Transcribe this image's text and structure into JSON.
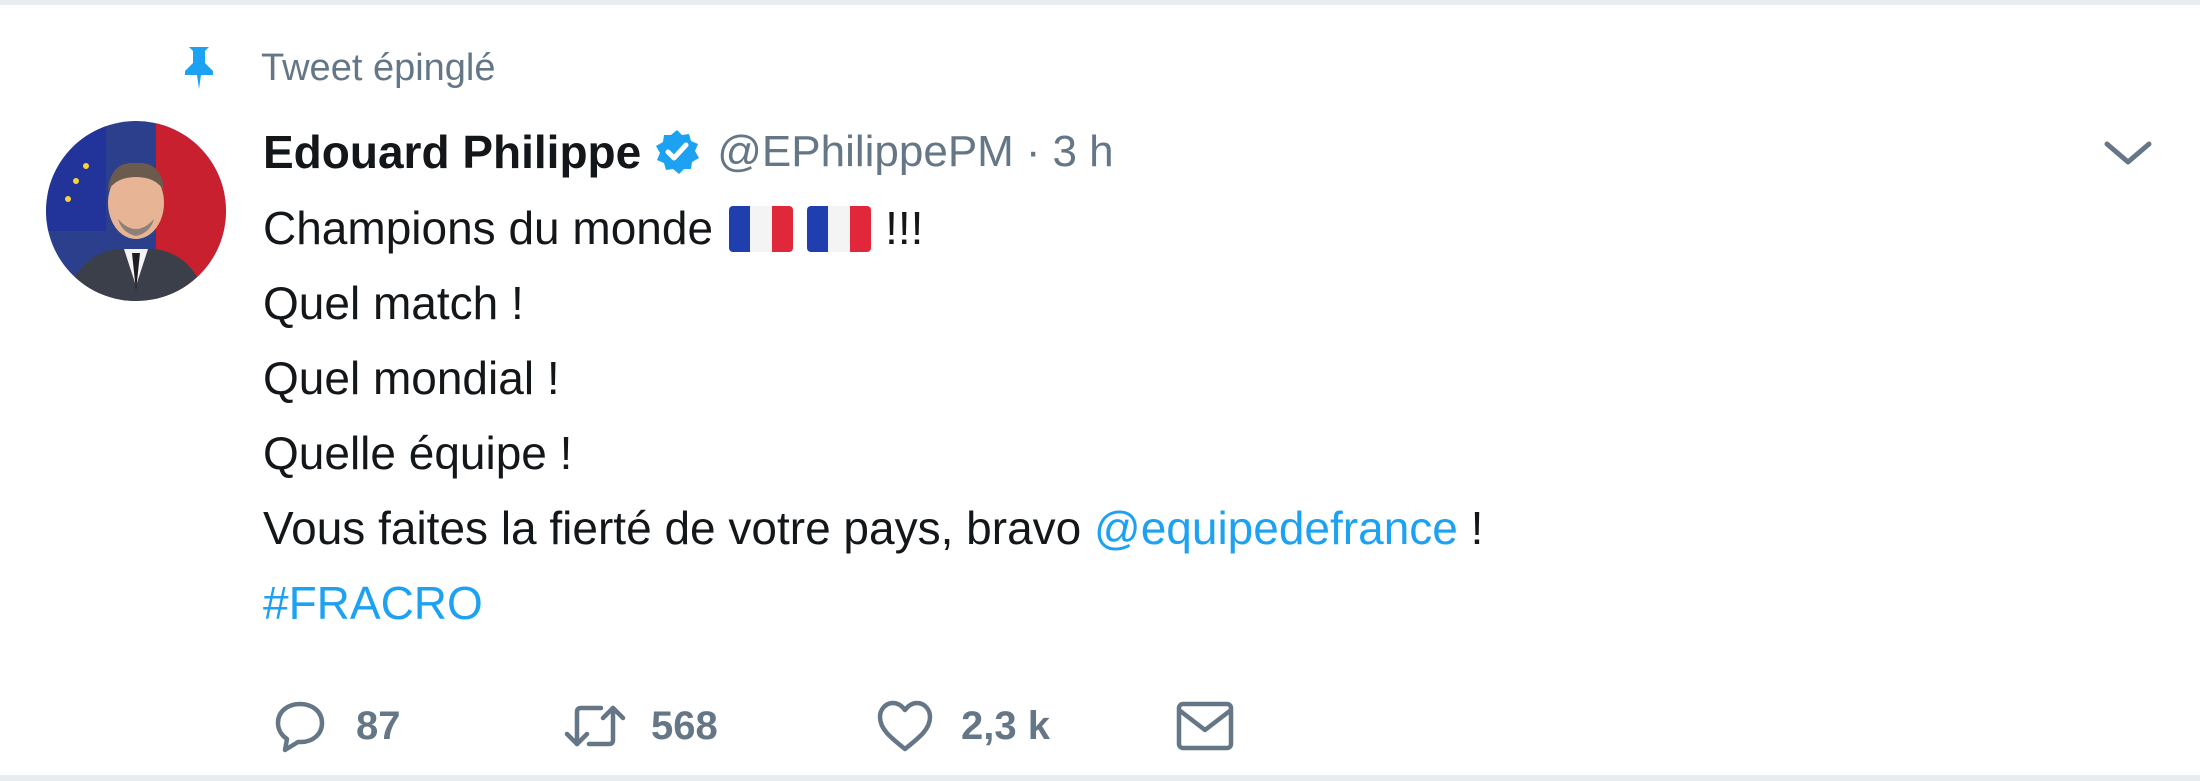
{
  "pinned": {
    "label": "Tweet épinglé",
    "icon": "pin-icon"
  },
  "author": {
    "name": "Edouard Philippe",
    "verified": true,
    "handle": "@EPhilippePM",
    "separator": "·",
    "time": "3 h",
    "avatar_icon": "avatar-photo"
  },
  "menu": {
    "icon": "chevron-down-icon"
  },
  "body": {
    "line1_text": "Champions du monde",
    "line1_suffix": "!!!",
    "line2": "Quel match !",
    "line3": "Quel mondial !",
    "line4": "Quelle équipe !",
    "line5_text": "Vous faites la fierté de votre pays, bravo",
    "line5_mention": "@equipedefrance",
    "line5_suffix": "!",
    "hashtag": "#FRACRO"
  },
  "actions": {
    "reply_count": "87",
    "retweet_count": "568",
    "like_count": "2,3 k"
  },
  "colors": {
    "accent": "#1da1f2",
    "text": "#14171a",
    "muted": "#657786",
    "flag_blue": "#1f3fae",
    "flag_red": "#e0283a"
  }
}
